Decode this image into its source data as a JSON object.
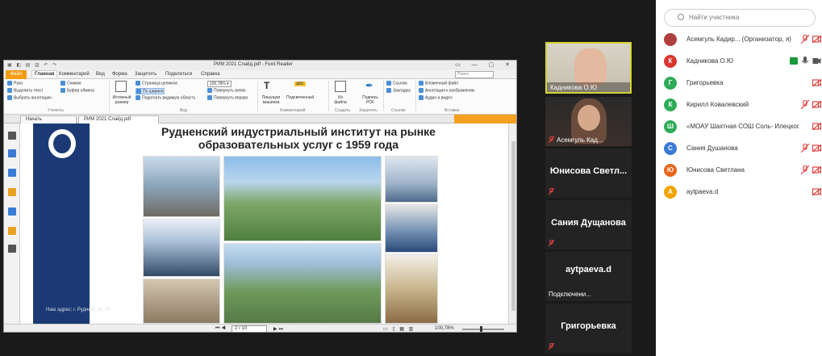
{
  "reader": {
    "window_title": "РИМ 2021 Слайд.pdf - Foxit Reader",
    "menu": {
      "file": "Файл",
      "items": [
        "Главная",
        "Комментарий",
        "Вид",
        "Форма",
        "Защитить",
        "Поделиться",
        "Справка"
      ],
      "search_placeholder": "Поиск"
    },
    "ribbon": {
      "hand": "Рука",
      "select_text": "Выделить текст",
      "select_annotation": "Выбрать аннотацию",
      "group_tools": "Утилиты",
      "snapshot": "Снимок",
      "clipboard": "Буфер обмена",
      "actual_size": "Истинный размер",
      "fit_page": "Страница целиком",
      "fit_width": "По ширине",
      "fit_visible": "Подогнать видимую область",
      "zoom_value": "100,78%",
      "rotate_left": "Повернуть влево",
      "rotate_right": "Повернуть вправо",
      "group_view": "Вид",
      "typewriter": "Пишущая машинка",
      "highlight": "Подсвеченный",
      "group_comment": "Комментарий",
      "from_file": "Из файла",
      "group_create": "Создать",
      "sign_pdf": "Подпись PDF",
      "group_protect": "Защитить",
      "link": "Ссылка",
      "bookmark": "Закладка",
      "group_links": "Ссылки",
      "attach_file": "Вложенный файл",
      "image_annotation": "Аннотация к изображению",
      "audio_video": "Аудио и видео",
      "group_insert": "Вставка"
    },
    "tabs": [
      "Начать",
      "РИМ 2021 Слайд.pdf"
    ],
    "slide": {
      "title": "Рудненский индустриальный институт на рынке образовательных услуг с 1959 года",
      "address": "Наш адрес: г. Рудный, ул. 50"
    },
    "status": {
      "page": "2 / 10",
      "zoom": "100,78%"
    }
  },
  "videos": [
    {
      "name": "Кадникова О.Ю",
      "type": "camera"
    },
    {
      "name": "Асемгуль Кад...",
      "type": "camera"
    },
    {
      "name": "Юнисова  Светл...",
      "type": "name"
    },
    {
      "name": "Сания Дущанова",
      "type": "name"
    },
    {
      "name": "aytpaeva.d",
      "type": "name",
      "status": "Подключени..."
    },
    {
      "name": "Григорьевка",
      "type": "name"
    }
  ],
  "participants": {
    "search_placeholder": "Найти участника",
    "list": [
      {
        "initial": "",
        "name": "Асемгуль Кадир...  (Организатор, я)",
        "color": "#b04040",
        "photo": true
      },
      {
        "initial": "К",
        "name": "Кадникова О.Ю",
        "color": "#d9372e"
      },
      {
        "initial": "Г",
        "name": "Григорьевка",
        "color": "#2eab57"
      },
      {
        "initial": "К",
        "name": "Кирилл Ковалевский",
        "color": "#2eab57"
      },
      {
        "initial": "Ш",
        "name": "«МОАУ Шахтная СОШ Соль- Илецког...",
        "color": "#2eab57"
      },
      {
        "initial": "С",
        "name": "Сания Душанова",
        "color": "#3a7bd5"
      },
      {
        "initial": "Ю",
        "name": "Юнисова Светлана",
        "color": "#e8651a"
      },
      {
        "initial": "А",
        "name": "aytpaeva.d",
        "color": "#f0a500"
      }
    ]
  },
  "colors": {
    "accent_file_tab": "#f39c12",
    "slide_strip": "#1b3a75",
    "muted_icon": "#e04040",
    "active_speaker_border": "#d4d430"
  }
}
